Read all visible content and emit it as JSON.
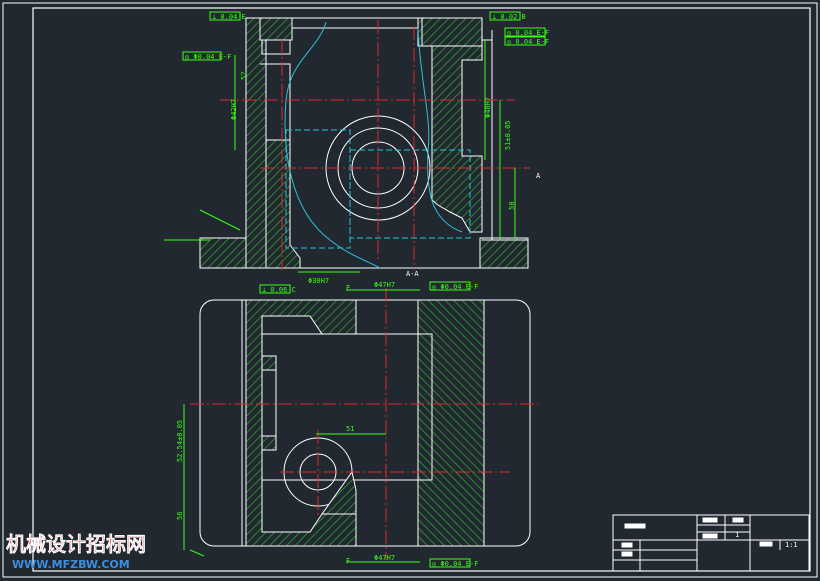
{
  "colors": {
    "background": "#212830",
    "outline": "#ffffff",
    "hatch": "#2f9e2f",
    "dimension": "#39ff14",
    "centerline": "#e0282e",
    "hidden": "#29c4d8",
    "watermark_cn": "#d64a3c",
    "watermark_url": "#3b8fe0"
  },
  "top_view": {
    "dims": {
      "bore_left": "Φ42H7",
      "bore_right": "Φ40H7",
      "bore_bottom": "Φ30H7",
      "height_a": "51±0.05",
      "height_b": "50",
      "small_52": "52"
    },
    "tolerances": {
      "flat_left": "⊥ 0.04 E",
      "flat_right": "⊥ 0.02 B",
      "perp_a": "◎ 0.04 E-F",
      "perp_b": "◎ 0.04 E-F",
      "left_callout": "◎ Φ0.04 E-F"
    },
    "section_marks": {
      "right": "A",
      "arrow_mark": "A-A"
    }
  },
  "bottom_view": {
    "dims": {
      "bore_top": "Φ47H7",
      "bore_bottom": "Φ47H7",
      "center_dist": "51",
      "vertical_a": "52.54±0.05",
      "vertical_b": "56"
    },
    "tolerances": {
      "flat_top": "⊥ 0.06 C",
      "coax_top": "◎ Φ0.04 E-F",
      "coax_bottom": "◎ Φ0.04 E-F"
    },
    "marks": {
      "f_top": "F",
      "f_bottom": "F"
    }
  },
  "title_block": {
    "qty": "1",
    "scale": "1:1"
  },
  "watermark": {
    "cn": "机械设计招标网",
    "url": "WWW.MFZBW.COM"
  }
}
